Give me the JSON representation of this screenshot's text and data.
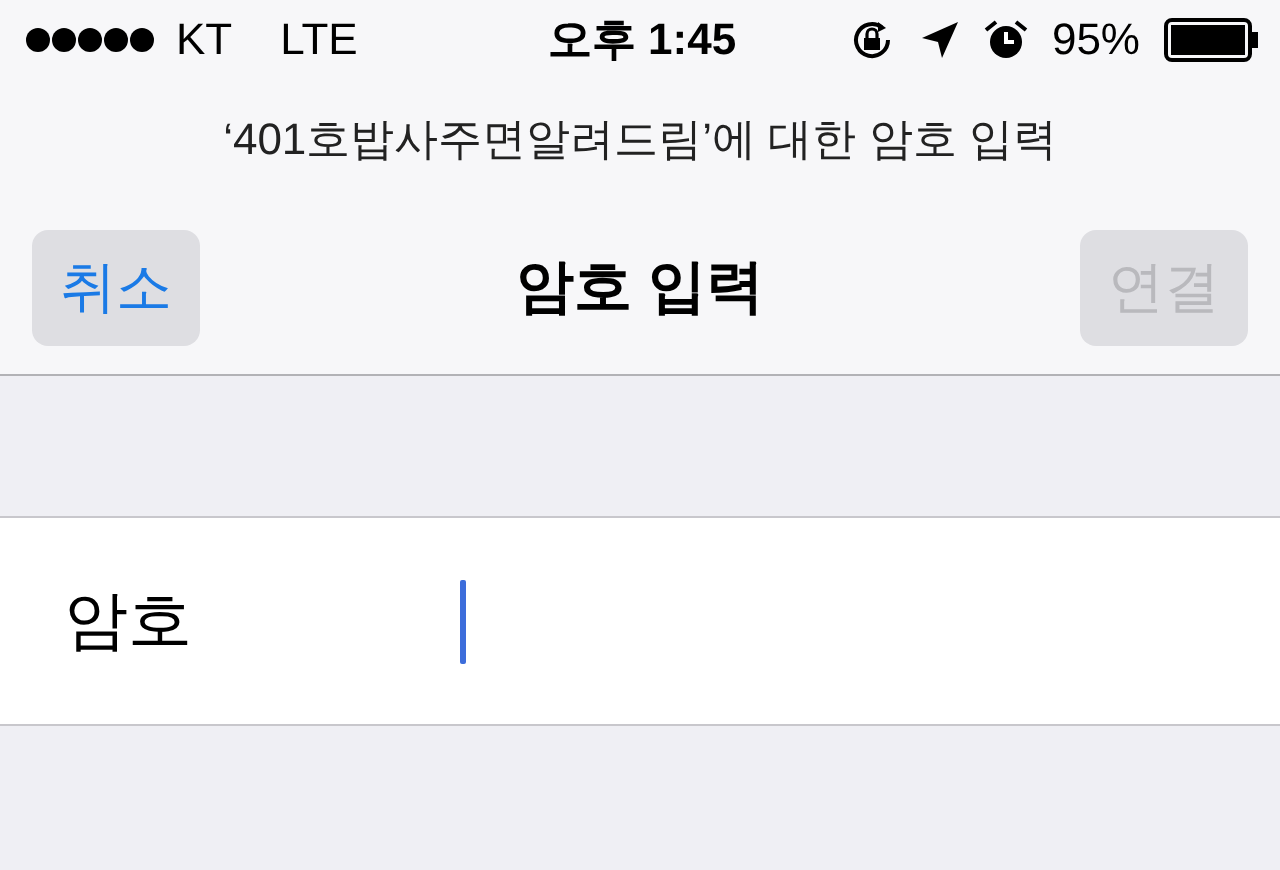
{
  "status_bar": {
    "carrier": "KT",
    "network": "LTE",
    "time": "오후 1:45",
    "battery": "95%"
  },
  "prompt": "‘401호밥사주면알려드림’에 대한 암호 입력",
  "nav_bar": {
    "title": "암호 입력",
    "buttons": [
      {
        "label": "취소",
        "disabled": false
      },
      {
        "label": "연결",
        "disabled": true
      }
    ]
  },
  "form": {
    "label": "암호",
    "focused": true
  }
}
